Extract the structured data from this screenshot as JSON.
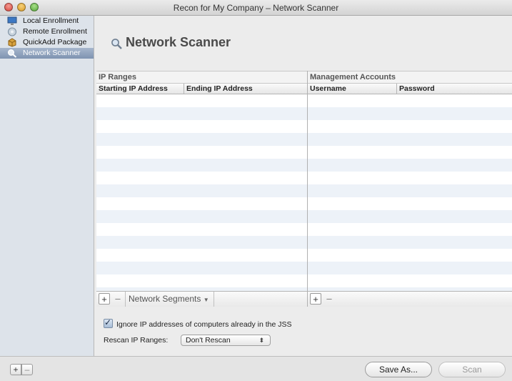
{
  "window": {
    "title": "Recon for My Company – Network Scanner"
  },
  "sidebar": {
    "items": [
      {
        "label": "Local Enrollment",
        "icon": "computer-icon",
        "selected": false
      },
      {
        "label": "Remote Enrollment",
        "icon": "remote-icon",
        "selected": false
      },
      {
        "label": "QuickAdd Package",
        "icon": "package-icon",
        "selected": false
      },
      {
        "label": "Network Scanner",
        "icon": "magnifier-icon",
        "selected": true
      }
    ]
  },
  "header": {
    "title": "Network Scanner",
    "icon": "magnifier-icon"
  },
  "ip_ranges": {
    "title": "IP Ranges",
    "columns": [
      "Starting IP Address",
      "Ending IP Address"
    ],
    "rows": [],
    "segments_label": "Network Segments"
  },
  "accounts": {
    "title": "Management Accounts",
    "columns": [
      "Username",
      "Password"
    ],
    "rows": []
  },
  "controls": {
    "plus": "+",
    "minus": "–",
    "ignore_label": "Ignore IP addresses of computers already in the JSS",
    "ignore_checked": true,
    "rescan_label": "Rescan IP Ranges:",
    "rescan_value": "Don't Rescan"
  },
  "footer": {
    "add": "+",
    "remove": "–",
    "save_as": "Save As...",
    "scan": "Scan"
  }
}
